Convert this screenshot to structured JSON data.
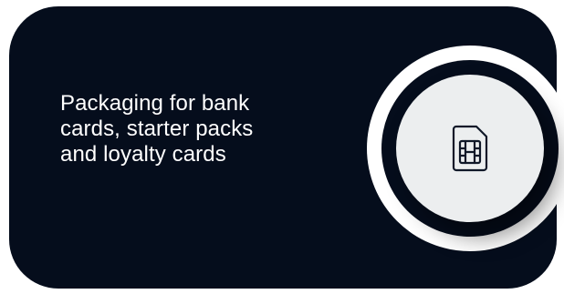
{
  "card": {
    "text": "Packaging for bank\ncards, starter packs\nand loyalty cards"
  },
  "icon": {
    "name": "sim-card-icon"
  },
  "colors": {
    "card_background": "#050d1c",
    "text": "#ffffff",
    "icon_circle": "#eceeef",
    "icon_stroke": "#101828"
  }
}
